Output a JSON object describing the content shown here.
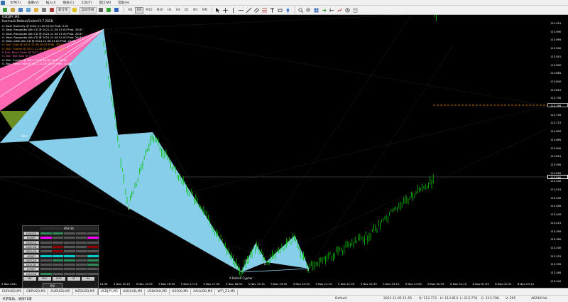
{
  "menu": [
    "文件(F)",
    "查看(V)",
    "插入(I)",
    "图表(C)",
    "工具(T)",
    "窗口(W)",
    "帮助(H)"
  ],
  "toolbar": {
    "new_order_label": "新订单",
    "auto_trading_label": "自动交易",
    "timeframes": [
      "M1",
      "M5",
      "M15",
      "M30",
      "H1",
      "H4",
      "D1",
      "W1",
      "MN"
    ],
    "active_timeframe": "M5"
  },
  "chart": {
    "title": "USDJPY,M5",
    "indicator_name": "HarmonicPatternFinderV3 7 2018",
    "pattern_list": [
      {
        "text": "O. Bear. Butterfly @ 2021.11.08 01:00 Prob. 0.00",
        "color": "#ffffff"
      },
      {
        "text": "O. Bear. RangeAbe AB=CD @ 2021.11.08 01:00 Prob. 26.67",
        "color": "#ffffff"
      },
      {
        "text": "O. Bear. RangeAbe AB=CD @ 2021.11.08 01:00 Prob. 26.67",
        "color": "#ffffff"
      },
      {
        "text": "O. Bear. RangeAbe AB=CD @ 2021.11.08 01:00 Prob. 26.67",
        "color": "#ffffff"
      },
      {
        "text": "O. Bear. Ideal AB=CD @ 2021.11.08 01:00 Prob. 23.33",
        "color": "#ffffff"
      },
      {
        "text": "O. Bull. Crab @ 2021.11.08 00:45 Prob. 30.00",
        "color": "#ff8c00"
      },
      {
        "text": "O. Bull. Cypher @ 2021.11.08 00:45 Prob. 46.00",
        "color": "#ff8c00"
      },
      {
        "text": "P. Bull. Black Swan @ 2021.11.05 21:15 Prob. 36.67",
        "color": "#ff69b4"
      },
      {
        "text": "O. Bull. Nen Star @ 2021.11.05 20:05 Prob. 26.67",
        "color": "#ff69b4"
      },
      {
        "text": "O. Bull. Cypher @ 2021.11.05 20:05 Prob. 26.67",
        "color": "#ffffff"
      },
      {
        "text": "O. Bull. Deep Crab @ 2021.11.05 20:05 Prob. 30.00",
        "color": "#ffffff"
      }
    ],
    "prices": [
      "114.015",
      "113.990",
      "113.965",
      "113.940",
      "113.915",
      "113.890",
      "113.865",
      "113.840",
      "113.815",
      "113.790",
      "113.765",
      "113.740",
      "113.715",
      "113.690",
      "113.665",
      "113.640",
      "113.615",
      "113.590",
      "113.565",
      "113.540",
      "113.515",
      "113.490",
      "113.465",
      "113.440",
      "113.415",
      "113.390",
      "113.365",
      "113.340",
      "113.315",
      "113.290",
      "113.265",
      "113.240"
    ],
    "current_price": "113.765",
    "bid_price": "113.560",
    "times": [
      "5 Nov 2021",
      "5 Nov 12:35",
      "5 Nov 13:15",
      "5 Nov 13:55",
      "5 Nov 14:35",
      "5 Nov 15:15",
      "5 Nov 15:55",
      "5 Nov 16:35",
      "5 Nov 17:15",
      "5 Nov 17:55",
      "5 Nov 18:35",
      "5 Nov 19:15",
      "5 Nov 19:55",
      "5 Nov 20:35",
      "5 Nov 21:15",
      "5 Nov 21:55",
      "5 Nov 22:35",
      "5 Nov 23:15",
      "5 Nov 23:55",
      "8 Nov 00:35",
      "8 Nov 01:15",
      "8 Nov 01:55",
      "8 Nov 02:35",
      "8 Nov 03:15"
    ],
    "point_labels": {
      "b": "B",
      "x": "X Bullish Cypher",
      "c": "C",
      "d": "D",
      "bear": "Bear",
      "small": "B"
    },
    "colors": {
      "pattern_fill": "#87ceeb",
      "pattern_pink": "#ff69b4",
      "candle": "#00c800",
      "level_line": "#ff8c00"
    }
  },
  "rsi_panel": {
    "header": "RSI (9)",
    "symbols": [
      "EURUSD",
      "EURJPY",
      "GBPUSD",
      "AUDUSD",
      "NZDUSD",
      "USDJPY",
      "USDCAD",
      "USDCHF",
      "EURJPY",
      "XAUUSD"
    ],
    "timeframes": [
      "M5",
      "M15",
      "M30",
      "H1",
      "H4"
    ],
    "cells": [
      [
        "#2e8b57",
        "#2e8b57",
        "#555555",
        "#555555",
        "#555555"
      ],
      [
        "#ff00ff",
        "#555555",
        "#555555",
        "#555555",
        "#ff00ff"
      ],
      [
        "#555555",
        "#555555",
        "#555555",
        "#555555",
        "#555555"
      ],
      [
        "#555555",
        "#8b0000",
        "#555555",
        "#555555",
        "#8b0000"
      ],
      [
        "#555555",
        "#8b0000",
        "#555555",
        "#555555",
        "#555555"
      ],
      [
        "#00ced1",
        "#00ced1",
        "#00ced1",
        "#555555",
        "#00ced1"
      ],
      [
        "#555555",
        "#2e8b57",
        "#2e8b57",
        "#555555",
        "#2e8b57"
      ],
      [
        "#555555",
        "#555555",
        "#555555",
        "#555555",
        "#2e8b57"
      ],
      [
        "#555555",
        "#555555",
        "#555555",
        "#555555",
        "#555555"
      ],
      [
        "#2e8b57",
        "#555555",
        "#555555",
        "#555555",
        "#555555"
      ]
    ],
    "button_label": "RSI"
  },
  "tabs": [
    "EURUSD,M5",
    "GBPUSD,M5",
    "AUDUSD,M5",
    "NZDUSD,M5",
    "USDJPY,M5",
    "USDCAD,M5",
    "USDCNH,M5",
    "US500,M5",
    "XAUUSD,M5",
    "WTI_Z1,M5"
  ],
  "active_tab": "USDJPY,M5",
  "status": {
    "help": "寻求帮助，请按F1键",
    "profile": "Default",
    "datetime": "2021.11.05 11:55",
    "open": "O: 113.773",
    "high": "H: 113.813",
    "low": "L: 113.778",
    "close": "C: 113.798",
    "volume": "V: 295",
    "traffic": "4629/0 kb"
  }
}
